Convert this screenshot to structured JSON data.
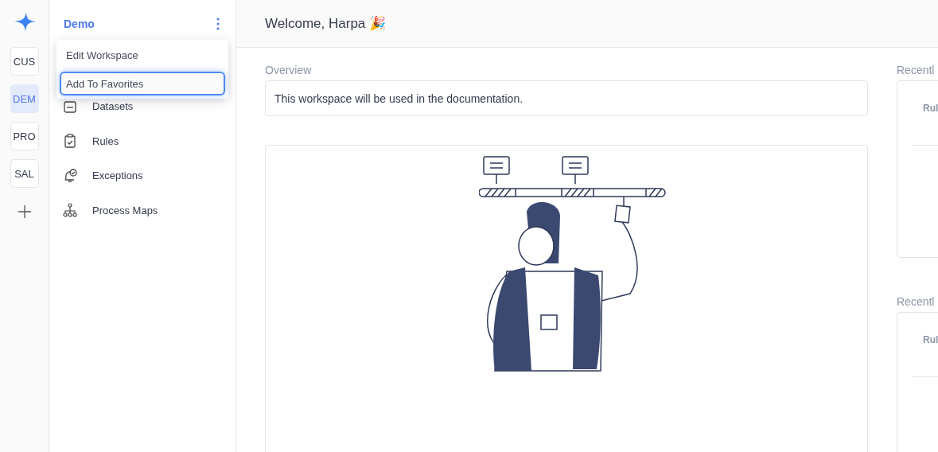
{
  "workspaces": [
    {
      "label": "CUS",
      "selected": false
    },
    {
      "label": "DEM",
      "selected": true
    },
    {
      "label": "PRO",
      "selected": false
    },
    {
      "label": "SAL",
      "selected": false
    }
  ],
  "sidebar": {
    "title": "Demo",
    "items": [
      {
        "label": "Datasets",
        "kind": "datasets"
      },
      {
        "label": "Rules",
        "kind": "rules"
      },
      {
        "label": "Exceptions",
        "kind": "exceptions"
      },
      {
        "label": "Process Maps",
        "kind": "process"
      }
    ]
  },
  "menu": {
    "items": [
      {
        "label": "Edit Workspace",
        "selected": false
      },
      {
        "label": "Add To Favorites",
        "selected": true
      }
    ]
  },
  "header": {
    "title": "Welcome, Harpa 🎉"
  },
  "overview": {
    "heading": "Overview",
    "text": "This workspace will be used in the documentation."
  },
  "right_panels": [
    {
      "heading": "Recentl",
      "column_1": "Rul"
    },
    {
      "heading": "Recentl",
      "column_1": "Rul"
    }
  ]
}
